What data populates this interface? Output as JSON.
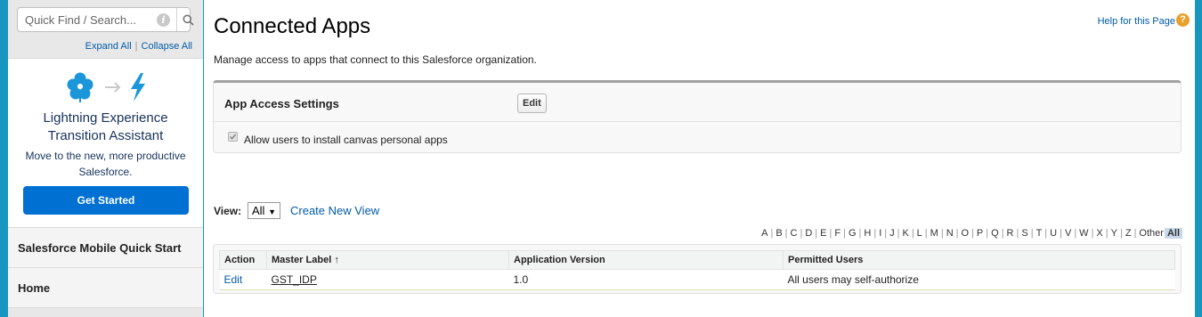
{
  "sidebar": {
    "search_placeholder": "Quick Find / Search...",
    "expand_all": "Expand All",
    "separator": "|",
    "collapse_all": "Collapse All",
    "lex_card": {
      "title_line1": "Lightning Experience",
      "title_line2": "Transition Assistant",
      "subtitle_line1": "Move to the new, more productive",
      "subtitle_line2": "Salesforce.",
      "button": "Get Started"
    },
    "items": [
      {
        "label": "Salesforce Mobile Quick Start"
      },
      {
        "label": "Home"
      }
    ]
  },
  "main": {
    "title": "Connected Apps",
    "help_link": "Help for this Page",
    "description": "Manage access to apps that connect to this Salesforce organization.",
    "settings": {
      "title": "App Access Settings",
      "edit_label": "Edit",
      "canvas_label": "Allow users to install canvas personal apps",
      "canvas_checked": true
    },
    "view": {
      "label": "View:",
      "selected": "All",
      "create_link": "Create New View"
    },
    "alpha": [
      "A",
      "B",
      "C",
      "D",
      "E",
      "F",
      "G",
      "H",
      "I",
      "J",
      "K",
      "L",
      "M",
      "N",
      "O",
      "P",
      "Q",
      "R",
      "S",
      "T",
      "U",
      "V",
      "W",
      "X",
      "Y",
      "Z",
      "Other",
      "All"
    ],
    "alpha_active": "All",
    "table": {
      "headers": [
        "Action",
        "Master Label",
        "Application Version",
        "Permitted Users"
      ],
      "sort_indicator": "↑",
      "rows": [
        {
          "action": "Edit",
          "master_label": "GST_IDP",
          "version": "1.0",
          "permitted_users": "All users may self-authorize"
        }
      ]
    }
  },
  "colors": {
    "background": "#1797c0",
    "link": "#015ba7",
    "primary_button": "#0070d2",
    "lex_flower": "#1b96d9"
  }
}
